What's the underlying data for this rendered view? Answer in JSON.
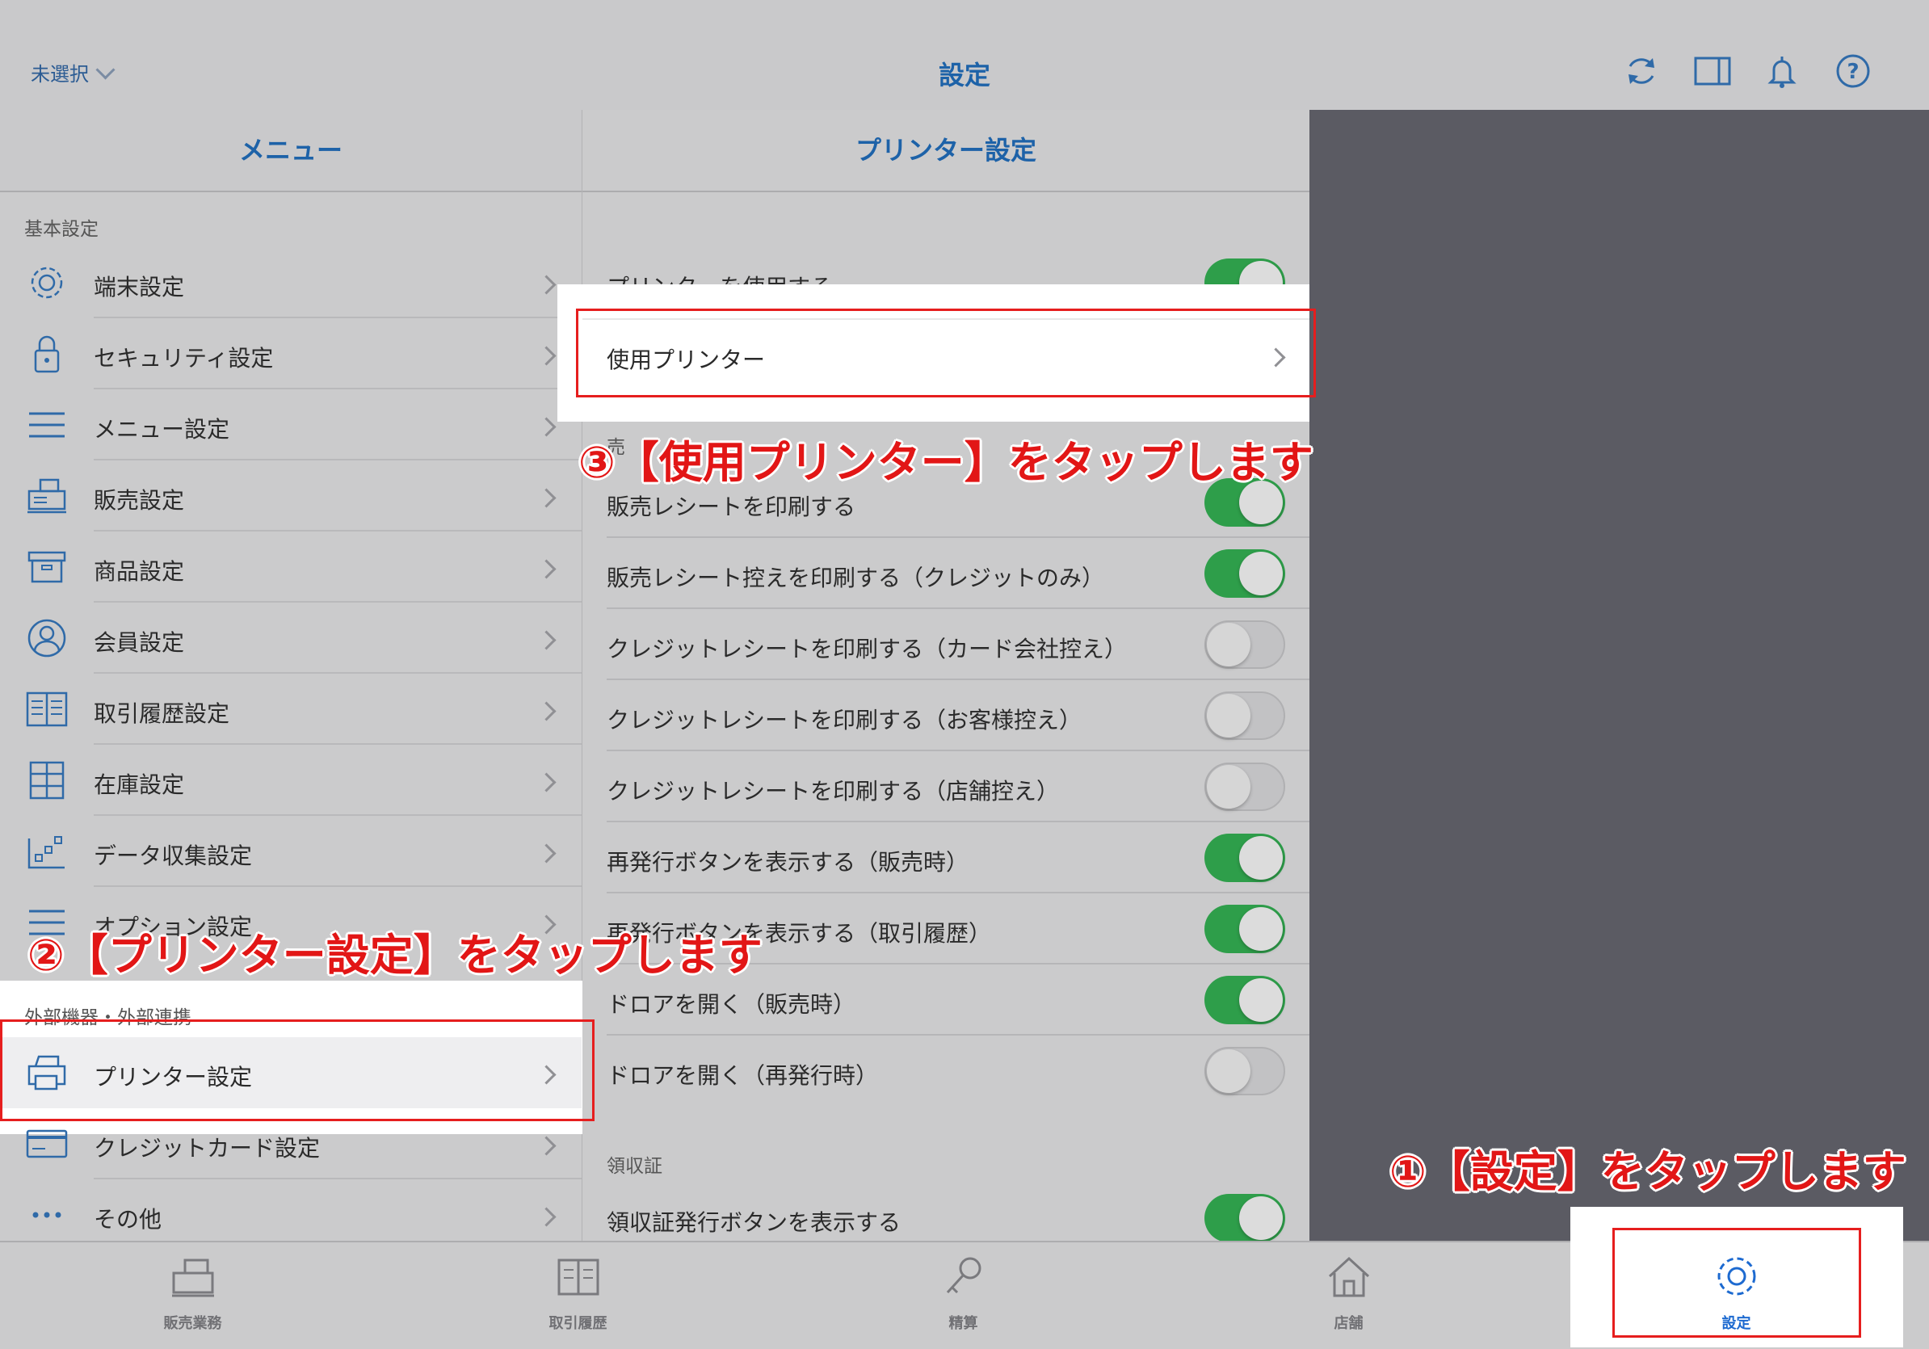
{
  "header": {
    "store_select": "未選択",
    "title": "設定",
    "icons": [
      "refresh-icon",
      "split-view-icon",
      "bell-icon",
      "help-icon"
    ]
  },
  "menu": {
    "title": "メニュー",
    "section_basic": "基本設定",
    "items_basic": [
      {
        "label": "端末設定",
        "icon": "gear-icon"
      },
      {
        "label": "セキュリティ設定",
        "icon": "lock-icon"
      },
      {
        "label": "メニュー設定",
        "icon": "list-icon"
      },
      {
        "label": "販売設定",
        "icon": "register-icon"
      },
      {
        "label": "商品設定",
        "icon": "box-icon"
      },
      {
        "label": "会員設定",
        "icon": "person-icon"
      },
      {
        "label": "取引履歴設定",
        "icon": "book-icon"
      },
      {
        "label": "在庫設定",
        "icon": "shelf-icon"
      },
      {
        "label": "データ収集設定",
        "icon": "data-icon"
      },
      {
        "label": "オプション設定",
        "icon": "option-icon"
      }
    ],
    "section_external": "外部機器・外部連携",
    "items_external": [
      {
        "label": "プリンター設定",
        "icon": "printer-icon"
      },
      {
        "label": "クレジットカード設定",
        "icon": "credit-card-icon"
      },
      {
        "label": "その他",
        "icon": "more-icon"
      }
    ]
  },
  "printer": {
    "title": "プリンター設定",
    "use_printer": {
      "label": "プリンターを使用する",
      "on": true
    },
    "selected_printer": "使用プリンター",
    "section_sales_partial": "売",
    "settings": [
      {
        "label": "販売レシートを印刷する",
        "on": true
      },
      {
        "label": "販売レシート控えを印刷する（クレジットのみ）",
        "on": true
      },
      {
        "label": "クレジットレシートを印刷する（カード会社控え）",
        "on": false
      },
      {
        "label": "クレジットレシートを印刷する（お客様控え）",
        "on": false
      },
      {
        "label": "クレジットレシートを印刷する（店舗控え）",
        "on": false
      },
      {
        "label": "再発行ボタンを表示する（販売時）",
        "on": true
      },
      {
        "label": "再発行ボタンを表示する（取引履歴）",
        "on": true
      },
      {
        "label": "ドロアを開く（販売時）",
        "on": true
      },
      {
        "label": "ドロアを開く（再発行時）",
        "on": false
      }
    ],
    "section_receipt": "領収証",
    "receipt_button": {
      "label": "領収証発行ボタンを表示する",
      "on": true
    }
  },
  "tabs": [
    {
      "label": "販売業務",
      "icon": "register-icon"
    },
    {
      "label": "取引履歴",
      "icon": "book-icon"
    },
    {
      "label": "精算",
      "icon": "key-icon"
    },
    {
      "label": "店舗",
      "icon": "house-icon"
    },
    {
      "label": "設定",
      "icon": "gear-icon"
    }
  ],
  "annotations": {
    "step1": "①【設定】をタップします",
    "step2": "②【プリンター設定】をタップします",
    "step3": "③【使用プリンター】をタップします"
  },
  "colors": {
    "accent": "#1d62a8",
    "toggle_on": "#2e9e4a",
    "annotation": "#e21616"
  }
}
